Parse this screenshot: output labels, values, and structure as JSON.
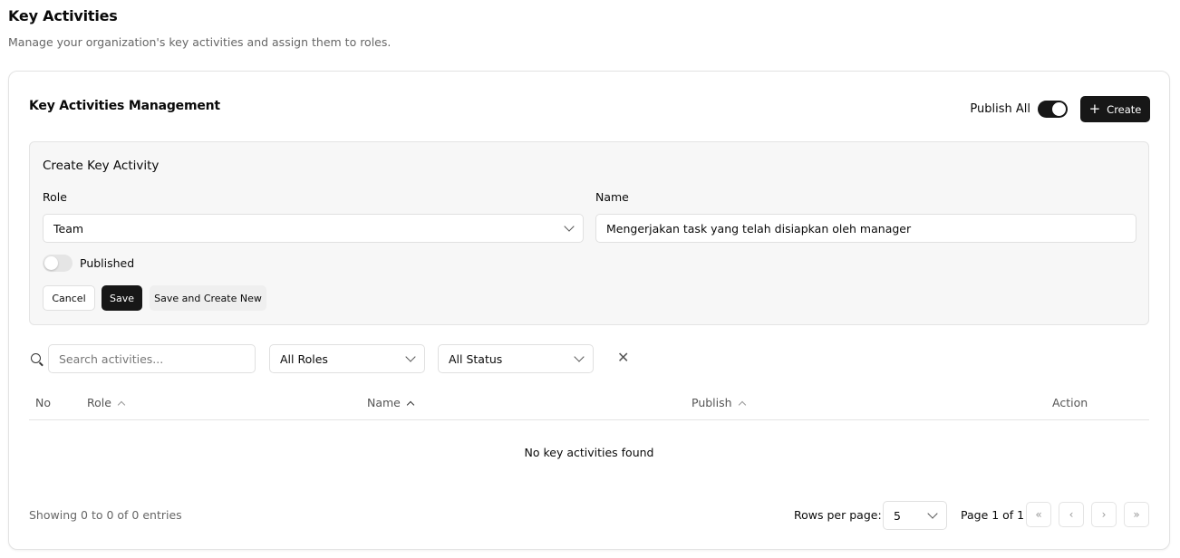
{
  "page": {
    "title": "Key Activities",
    "subtitle": "Manage your organization's key activities and assign them to roles."
  },
  "card": {
    "title": "Key Activities Management",
    "publish_all_label": "Publish All",
    "publish_all_on": true,
    "create_label": "Create",
    "create_icon": "plus-icon"
  },
  "form": {
    "title": "Create Key Activity",
    "role_label": "Role",
    "role_value": "Team",
    "name_label": "Name",
    "name_value": "Mengerjakan task yang telah disiapkan oleh manager",
    "published_label": "Published",
    "published_on": false,
    "cancel_label": "Cancel",
    "save_label": "Save",
    "save_new_label": "Save and Create New"
  },
  "filters": {
    "search_placeholder": "Search activities...",
    "role_filter": "All Roles",
    "status_filter": "All Status",
    "clear_icon": "close-icon"
  },
  "table": {
    "columns": [
      "No",
      "Role",
      "Name",
      "Publish",
      "Action"
    ],
    "empty_message": "No key activities found"
  },
  "footer": {
    "showing": "Showing 0 to 0 of 0 entries",
    "rows_per_page_label": "Rows per page:",
    "rows_per_page_value": "5",
    "page_info": "Page 1 of 1",
    "first_icon": "«",
    "prev_icon": "‹",
    "next_icon": "›",
    "last_icon": "»"
  },
  "colors": {
    "primary": "#171717",
    "panel_bg": "#f7f7f7",
    "border": "#e4e4e4"
  }
}
